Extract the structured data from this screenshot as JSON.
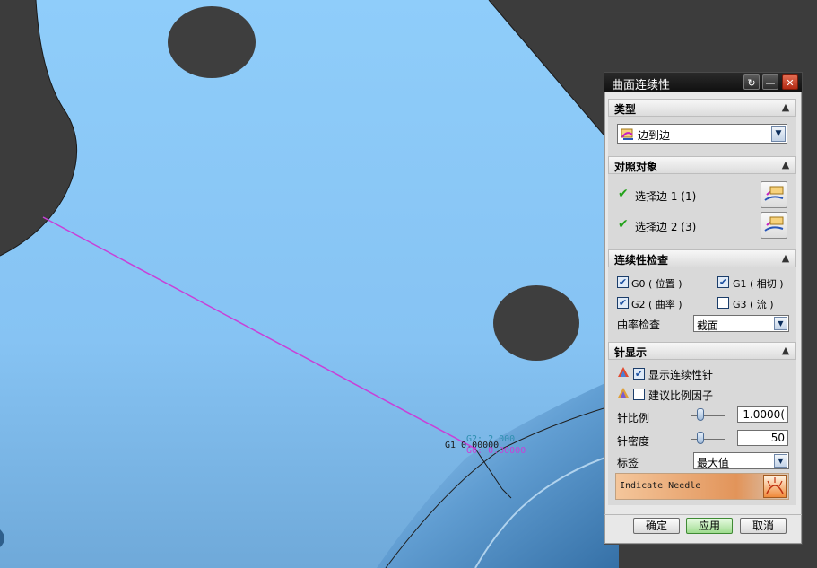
{
  "viewport": {
    "annotation_g2": "G2: 2.000",
    "annotation_g1": "G1  0.00000",
    "annotation_g0": "G0: 0.00000"
  },
  "dialog": {
    "title": "曲面连续性",
    "title_buttons": {
      "reset": "↻",
      "minimize": "—",
      "close": "✕"
    },
    "sections": {
      "type": {
        "header": "类型",
        "selected": "边到边"
      },
      "compare": {
        "header": "对照对象",
        "edge1": "选择边 1 (1)",
        "edge2": "选择边 2 (3)"
      },
      "continuity": {
        "header": "连续性检查",
        "g0": {
          "label": "G0 ( 位置 )",
          "checked": true
        },
        "g1": {
          "label": "G1 ( 相切 )",
          "checked": true
        },
        "g2": {
          "label": "G2 ( 曲率 )",
          "checked": true
        },
        "g3": {
          "label": "G3 ( 流 )",
          "checked": false
        },
        "curvature_label": "曲率检查",
        "curvature_value": "截面"
      },
      "needle": {
        "header": "针显示",
        "show_needle": {
          "label": "显示连续性针",
          "checked": true
        },
        "suggest_scale": {
          "label": "建议比例因子",
          "checked": false
        },
        "scale_label": "针比例",
        "scale_value": "1.0000(",
        "density_label": "针密度",
        "density_value": "50",
        "tag_label": "标签",
        "tag_value": "最大值",
        "indicate_label": "Indicate Needle"
      }
    },
    "buttons": {
      "ok": "确定",
      "apply": "应用",
      "cancel": "取消"
    }
  }
}
